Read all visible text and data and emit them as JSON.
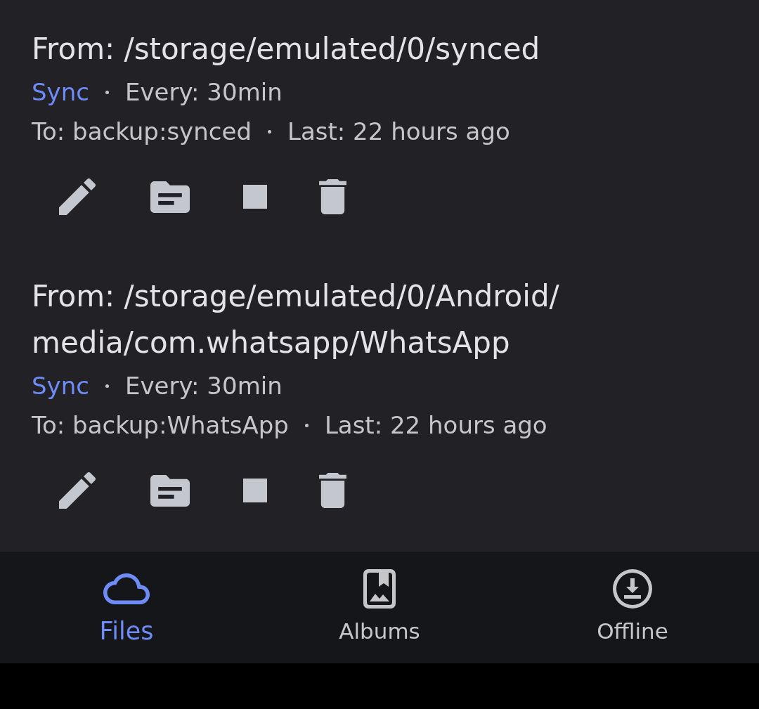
{
  "jobs": [
    {
      "from": "From: /storage/emulated/0/synced",
      "mode": "Sync",
      "interval": "Every: 30min",
      "to": "To: backup:synced",
      "last": "Last: 22 hours ago",
      "running": true
    },
    {
      "from": "From: /storage/emulated/0/Android/media/com.whatsapp/WhatsApp",
      "mode": "Sync",
      "interval": "Every: 30min",
      "to": "To: backup:WhatsApp",
      "last": "Last: 22 hours ago",
      "running": true
    }
  ],
  "bottom_nav": [
    {
      "label": "Files",
      "kind": "cloud",
      "selected": true
    },
    {
      "label": "Albums",
      "kind": "album",
      "selected": false
    },
    {
      "label": "Offline",
      "kind": "download",
      "selected": false
    }
  ]
}
